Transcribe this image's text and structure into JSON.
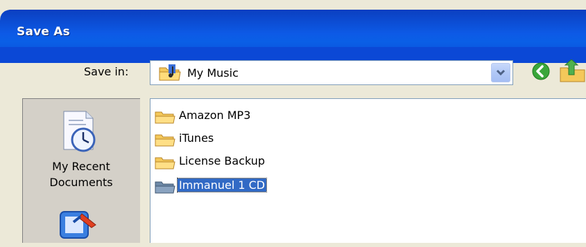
{
  "window": {
    "title": "Save As"
  },
  "toolbar": {
    "save_in_label": "Save in:",
    "save_in_value": "My Music",
    "back_icon": "green-back-arrow-icon",
    "up_icon": "folder-up-icon"
  },
  "places": [
    {
      "label_line1": "My Recent",
      "label_line2": "Documents",
      "icon": "recent-documents-icon"
    },
    {
      "label_line1": "",
      "label_line2": "",
      "icon": "desktop-icon"
    }
  ],
  "files": [
    {
      "name": "Amazon MP3",
      "selected": false
    },
    {
      "name": "iTunes",
      "selected": false
    },
    {
      "name": "License Backup",
      "selected": false
    },
    {
      "name": "Immanuel 1 CD",
      "selected": true
    }
  ],
  "colors": {
    "titlebar": "#0a5fe6",
    "selection": "#316ac5",
    "dialog_bg": "#ece9d8"
  }
}
